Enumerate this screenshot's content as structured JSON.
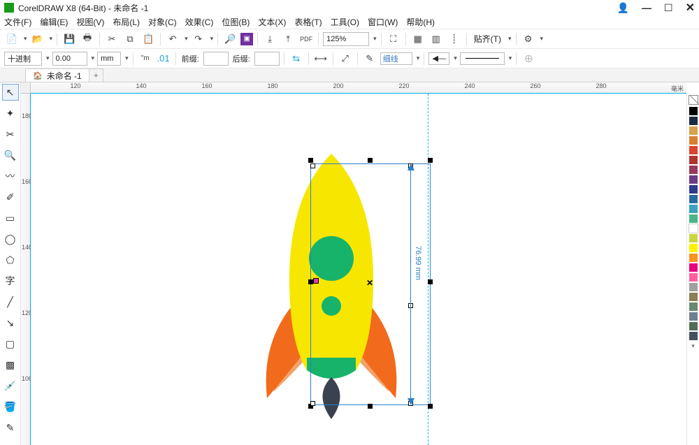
{
  "titlebar": {
    "title": "CorelDRAW X8 (64-Bit) - 未命名 -1"
  },
  "menus": [
    "文件(F)",
    "编辑(E)",
    "视图(V)",
    "布局(L)",
    "对象(C)",
    "效果(C)",
    "位图(B)",
    "文本(X)",
    "表格(T)",
    "工具(O)",
    "窗口(W)",
    "帮助(H)"
  ],
  "toolbar1": {
    "zoom_value": "125%",
    "align_label": "贴齐(T)"
  },
  "toolbar2": {
    "numeric_mode": "十进制",
    "current_value": "0.00",
    "unit": "mm",
    "prefix_label": "前缀:",
    "suffix_label": "后缀:",
    "outline_value": "细线"
  },
  "tab": {
    "name": "未命名 -1"
  },
  "ruler": {
    "h_labels": [
      120,
      140,
      160,
      180,
      200,
      220,
      240,
      260,
      280
    ],
    "h_unit": "毫米",
    "v_labels": [
      180,
      160,
      140,
      120,
      100
    ]
  },
  "dimension": {
    "value": "76.99 mm"
  },
  "palette_colors": [
    "#000000",
    "#1a2a44",
    "#d4a24a",
    "#d97f32",
    "#d9442e",
    "#b0342e",
    "#963a5e",
    "#6e3a84",
    "#2e3a8a",
    "#2a6aa0",
    "#3aa3c0",
    "#4bb68a",
    "#ffffff",
    "#c9d640",
    "#fff200",
    "#f7931e",
    "#e6007e",
    "#ff5fa2",
    "#a0a0a0",
    "#8a7f55",
    "#6a886f",
    "#6f8090",
    "#556b5a",
    "#445060"
  ]
}
